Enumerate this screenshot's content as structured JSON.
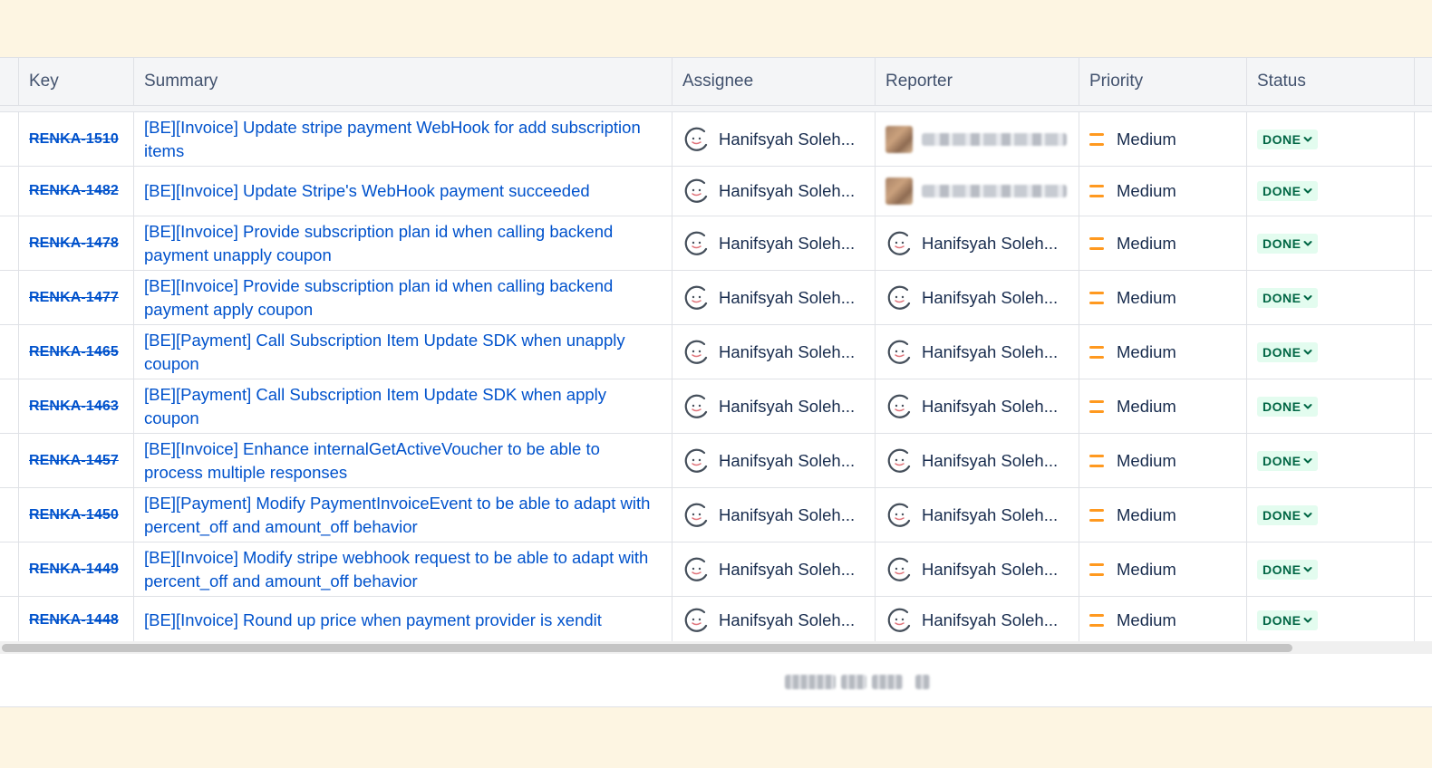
{
  "columns": {
    "key": "Key",
    "summary": "Summary",
    "assignee": "Assignee",
    "reporter": "Reporter",
    "priority": "Priority",
    "status": "Status"
  },
  "rows": [
    {
      "key": "RENKA-1510",
      "summary": "[BE][Invoice] Update stripe payment WebHook for add subscription items",
      "assignee": "Hanifsyah Soleh...",
      "reporter": "",
      "reporter_redacted": true,
      "priority": "Medium",
      "status": "DONE"
    },
    {
      "key": "RENKA-1482",
      "summary": "[BE][Invoice] Update Stripe's WebHook payment succeeded",
      "assignee": "Hanifsyah Soleh...",
      "reporter": "",
      "reporter_redacted": true,
      "priority": "Medium",
      "status": "DONE"
    },
    {
      "key": "RENKA-1478",
      "summary": "[BE][Invoice] Provide subscription plan id when calling backend payment unapply coupon",
      "assignee": "Hanifsyah Soleh...",
      "reporter": "Hanifsyah Soleh...",
      "priority": "Medium",
      "status": "DONE"
    },
    {
      "key": "RENKA-1477",
      "summary": "[BE][Invoice] Provide subscription plan id when calling backend payment apply coupon",
      "assignee": "Hanifsyah Soleh...",
      "reporter": "Hanifsyah Soleh...",
      "priority": "Medium",
      "status": "DONE"
    },
    {
      "key": "RENKA-1465",
      "summary": "[BE][Payment] Call Subscription Item Update SDK when unapply coupon",
      "assignee": "Hanifsyah Soleh...",
      "reporter": "Hanifsyah Soleh...",
      "priority": "Medium",
      "status": "DONE"
    },
    {
      "key": "RENKA-1463",
      "summary": "[BE][Payment] Call Subscription Item Update SDK when apply coupon",
      "assignee": "Hanifsyah Soleh...",
      "reporter": "Hanifsyah Soleh...",
      "priority": "Medium",
      "status": "DONE"
    },
    {
      "key": "RENKA-1457",
      "summary": "[BE][Invoice] Enhance internalGetActiveVoucher to be able to process multiple responses",
      "assignee": "Hanifsyah Soleh...",
      "reporter": "Hanifsyah Soleh...",
      "priority": "Medium",
      "status": "DONE"
    },
    {
      "key": "RENKA-1450",
      "summary": "[BE][Payment] Modify PaymentInvoiceEvent to be able to adapt with percent_off and amount_off behavior",
      "assignee": "Hanifsyah Soleh...",
      "reporter": "Hanifsyah Soleh...",
      "priority": "Medium",
      "status": "DONE"
    },
    {
      "key": "RENKA-1449",
      "summary": "[BE][Invoice] Modify stripe webhook request to be able to adapt with percent_off and amount_off behavior",
      "assignee": "Hanifsyah Soleh...",
      "reporter": "Hanifsyah Soleh...",
      "priority": "Medium",
      "status": "DONE"
    },
    {
      "key": "RENKA-1448",
      "summary": "[BE][Invoice] Round up price when payment provider is xendit",
      "assignee": "Hanifsyah Soleh...",
      "reporter": "Hanifsyah Soleh...",
      "priority": "Medium",
      "status": "DONE"
    }
  ],
  "icons": {
    "priority": "priority-medium-icon",
    "status_dropdown": "chevron-down-icon",
    "avatar": "avatar-icon"
  },
  "colors": {
    "link": "#0052cc",
    "priority_medium": "#ff991f",
    "status_done_bg": "#e3fcef",
    "status_done_text": "#006644",
    "background": "#fdf5e2"
  }
}
